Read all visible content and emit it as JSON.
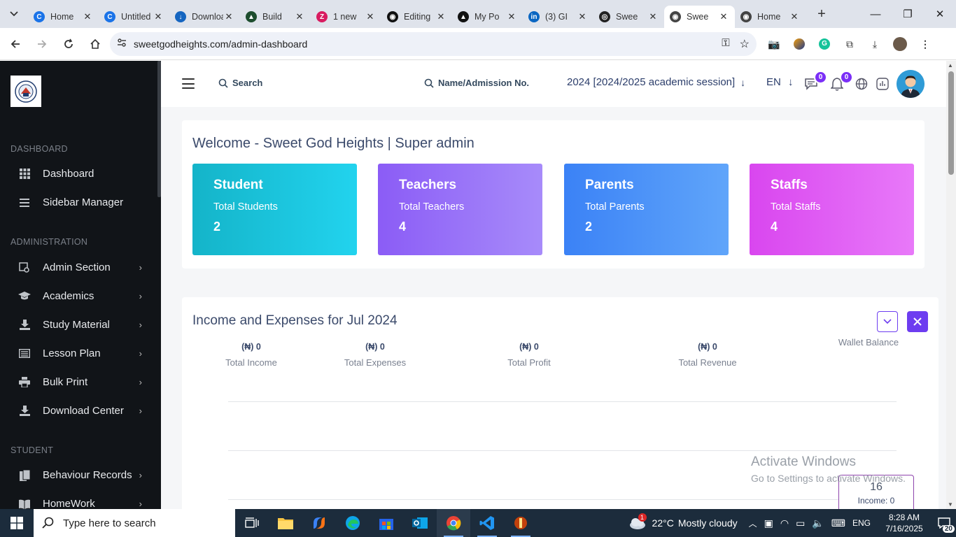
{
  "browser": {
    "tabs": [
      {
        "label": "Home",
        "color": "#1a73e8",
        "glyph": "C"
      },
      {
        "label": "Untitled",
        "color": "#1a73e8",
        "glyph": "C"
      },
      {
        "label": "Download",
        "color": "#1565c0",
        "glyph": "↓"
      },
      {
        "label": "Build",
        "color": "#1d4d2e",
        "glyph": "▲"
      },
      {
        "label": "1 new",
        "color": "#d81b60",
        "glyph": "Z"
      },
      {
        "label": "Editing",
        "color": "#111111",
        "glyph": "◉"
      },
      {
        "label": "My Po",
        "color": "#111111",
        "glyph": "▲"
      },
      {
        "label": "(3) GI",
        "color": "#0a66c2",
        "glyph": "in"
      },
      {
        "label": "Swee",
        "color": "#222222",
        "glyph": "◎"
      },
      {
        "label": "Swee",
        "color": "#444444",
        "glyph": "◉",
        "active": true
      },
      {
        "label": "Home",
        "color": "#444444",
        "glyph": "◉"
      }
    ],
    "url": "sweetgodheights.com/admin-dashboard"
  },
  "sidebar": {
    "sections": {
      "dashboard": "DASHBOARD",
      "administration": "ADMINISTRATION",
      "student": "STUDENT"
    },
    "items": [
      {
        "label": "Dashboard",
        "icon": "grid-icon"
      },
      {
        "label": "Sidebar Manager",
        "icon": "menu-icon"
      },
      {
        "label": "Admin Section",
        "icon": "admin-icon"
      },
      {
        "label": "Academics",
        "icon": "graduation-cap-icon"
      },
      {
        "label": "Study Material",
        "icon": "download-icon"
      },
      {
        "label": "Lesson Plan",
        "icon": "list-icon"
      },
      {
        "label": "Bulk Print",
        "icon": "printer-icon"
      },
      {
        "label": "Download Center",
        "icon": "download-icon"
      },
      {
        "label": "Behaviour Records",
        "icon": "records-icon"
      },
      {
        "label": "HomeWork",
        "icon": "book-icon"
      }
    ]
  },
  "header": {
    "search_label": "Search",
    "admission_search_label": "Name/Admission No.",
    "session": "2024 [2024/2025 academic session]",
    "language": "EN",
    "messages_count": "0",
    "notifications_count": "0"
  },
  "welcome": {
    "title": "Welcome - Sweet God Heights | Super admin",
    "stats": [
      {
        "title": "Student",
        "label": "Total Students",
        "value": "2",
        "from": "#14b4c9",
        "to": "#22d3ee"
      },
      {
        "title": "Teachers",
        "label": "Total Teachers",
        "value": "4",
        "from": "#8b5cf6",
        "to": "#a78bfa"
      },
      {
        "title": "Parents",
        "label": "Total Parents",
        "value": "2",
        "from": "#3b82f6",
        "to": "#60a5fa"
      },
      {
        "title": "Staffs",
        "label": "Total Staffs",
        "value": "4",
        "from": "#d946ef",
        "to": "#e879f9"
      }
    ]
  },
  "finance": {
    "title": "Income and Expenses for Jul 2024",
    "metrics": [
      {
        "value": "(₦) 0",
        "label": "Total Income"
      },
      {
        "value": "(₦) 0",
        "label": "Total Expenses"
      },
      {
        "value": "(₦) 0",
        "label": "Total Profit"
      },
      {
        "value": "(₦) 0",
        "label": "Total Revenue"
      },
      {
        "value": "",
        "label": "Wallet Balance"
      }
    ],
    "tooltip": {
      "day": "16",
      "income": "Income: 0"
    }
  },
  "watermark": {
    "line1": "Activate Windows",
    "line2": "Go to Settings to activate Windows."
  },
  "taskbar": {
    "search_placeholder": "Type here to search",
    "weather_temp": "22°C",
    "weather_text": "Mostly cloudy",
    "weather_badge": "1",
    "language": "ENG",
    "time": "8:28 AM",
    "date": "7/16/2025",
    "notifications": "20"
  },
  "colors": {
    "accent": "#6d3df0",
    "sidebar_bg": "#111418"
  }
}
